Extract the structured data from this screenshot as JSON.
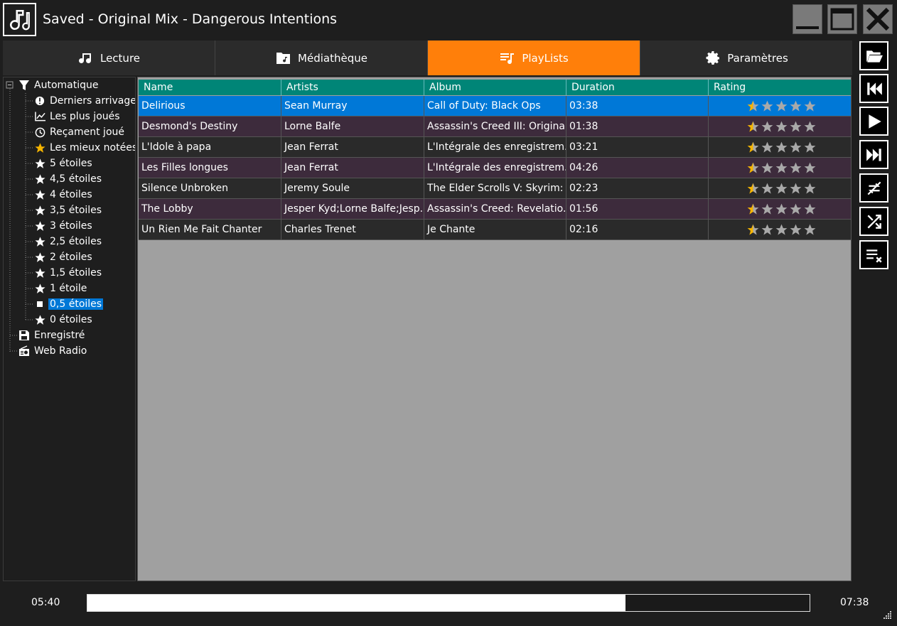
{
  "window": {
    "title": "Saved - Original Mix - Dangerous Intentions"
  },
  "tabs": [
    {
      "label": "Lecture",
      "icon": "music-note-icon",
      "active": false
    },
    {
      "label": "Médiathèque",
      "icon": "folder-music-icon",
      "active": false
    },
    {
      "label": "PlayLists",
      "icon": "playlist-icon",
      "active": true
    },
    {
      "label": "Paramètres",
      "icon": "gear-icon",
      "active": false
    }
  ],
  "tree": {
    "root": {
      "label": "Automatique",
      "icon": "filter-icon"
    },
    "children": [
      {
        "label": "Derniers arrivages",
        "icon": "new-badge-icon"
      },
      {
        "label": "Les plus joués",
        "icon": "chart-icon"
      },
      {
        "label": "Reçament joué",
        "icon": "clock-icon"
      },
      {
        "label": "Les mieux notées",
        "icon": "star-gold-icon"
      },
      {
        "label": "5 étoiles",
        "icon": "star-icon"
      },
      {
        "label": "4,5 étoiles",
        "icon": "star-icon"
      },
      {
        "label": "4 étoiles",
        "icon": "star-icon"
      },
      {
        "label": "3,5 étoiles",
        "icon": "star-icon"
      },
      {
        "label": "3 étoiles",
        "icon": "star-icon"
      },
      {
        "label": "2,5 étoiles",
        "icon": "star-icon"
      },
      {
        "label": "2 étoiles",
        "icon": "star-icon"
      },
      {
        "label": "1,5 étoiles",
        "icon": "star-icon"
      },
      {
        "label": "1 étoile",
        "icon": "star-icon"
      },
      {
        "label": "0,5 étoiles",
        "icon": "square-icon",
        "selected": true
      },
      {
        "label": "0 étoiles",
        "icon": "star-icon"
      }
    ],
    "others": [
      {
        "label": "Enregistré",
        "icon": "save-icon"
      },
      {
        "label": "Web Radio",
        "icon": "radio-icon"
      }
    ]
  },
  "grid": {
    "columns": [
      "Name",
      "Artists",
      "Album",
      "Duration",
      "Rating"
    ],
    "rows": [
      {
        "name": "Delirious",
        "artists": "Sean Murray",
        "album": "Call of Duty: Black Ops",
        "duration": "03:38",
        "rating": 0.5,
        "selected": true
      },
      {
        "name": "Desmond's Destiny",
        "artists": "Lorne Balfe",
        "album": "Assassin's Creed III: Origina...",
        "duration": "01:38",
        "rating": 0.5
      },
      {
        "name": "L'Idole à papa",
        "artists": "Jean Ferrat",
        "album": "L'Intégrale des enregistrem...",
        "duration": "03:21",
        "rating": 0.5
      },
      {
        "name": "Les Filles longues",
        "artists": "Jean Ferrat",
        "album": "L'Intégrale des enregistrem...",
        "duration": "04:26",
        "rating": 0.5
      },
      {
        "name": "Silence Unbroken",
        "artists": "Jeremy Soule",
        "album": "The Elder Scrolls V: Skyrim: ...",
        "duration": "02:23",
        "rating": 0.5
      },
      {
        "name": "The Lobby",
        "artists": "Jesper Kyd;Lorne Balfe;Jesp...",
        "album": "Assassin's Creed: Revelatio...",
        "duration": "01:56",
        "rating": 0.5
      },
      {
        "name": "Un Rien Me Fait Chanter",
        "artists": "Charles Trenet",
        "album": "Je Chante",
        "duration": "02:16",
        "rating": 0.5
      }
    ]
  },
  "toolbar": [
    "open-folder-icon",
    "previous-icon",
    "play-icon",
    "next-icon",
    "repeat-off-icon",
    "shuffle-icon",
    "clear-playlist-icon"
  ],
  "player": {
    "current_time": "05:40",
    "total_time": "07:38",
    "progress": 0.745
  },
  "colors": {
    "accent": "#ff7f0a",
    "header": "#008577",
    "selection": "#0078d7",
    "star": "#f5b400"
  }
}
